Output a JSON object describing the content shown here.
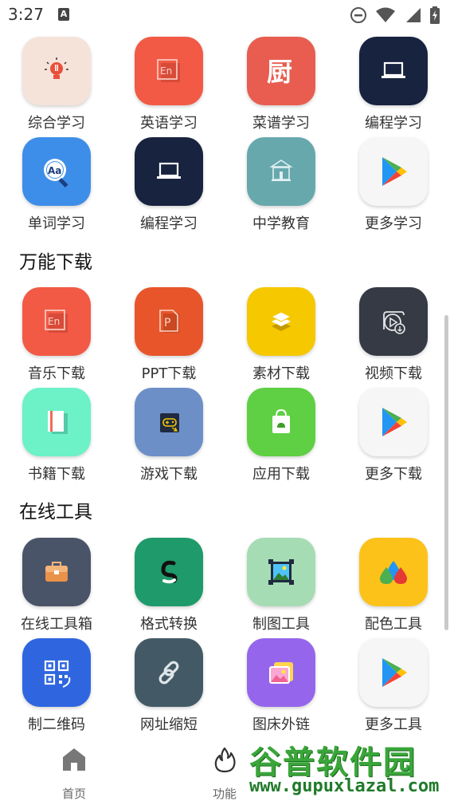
{
  "status_bar": {
    "time": "3:27",
    "notification_icon": "A"
  },
  "sections": [
    {
      "title": "",
      "items": [
        {
          "label": "综合学习",
          "icon": "lightbulb-icon",
          "color": "#f5e3da"
        },
        {
          "label": "英语学习",
          "icon": "en-doc-icon",
          "color": "#f25a45"
        },
        {
          "label": "菜谱学习",
          "icon": "chu-character-icon",
          "color": "#e85d50"
        },
        {
          "label": "编程学习",
          "icon": "laptop-icon",
          "color": "#17233f"
        },
        {
          "label": "单词学习",
          "icon": "magnifier-aa-icon",
          "color": "#3d8ee8"
        },
        {
          "label": "编程学习",
          "icon": "laptop-icon",
          "color": "#17233f"
        },
        {
          "label": "中学教育",
          "icon": "school-icon",
          "color": "#67a8ad"
        },
        {
          "label": "更多学习",
          "icon": "play-store-icon",
          "color": "#f6f6f6"
        }
      ]
    },
    {
      "title": "万能下载",
      "items": [
        {
          "label": "音乐下载",
          "icon": "en-doc-icon",
          "color": "#f25a45"
        },
        {
          "label": "PPT下载",
          "icon": "ppt-icon",
          "color": "#e8552a"
        },
        {
          "label": "素材下载",
          "icon": "layers-icon",
          "color": "#f5c800"
        },
        {
          "label": "视频下载",
          "icon": "video-download-icon",
          "color": "#353a44"
        },
        {
          "label": "书籍下载",
          "icon": "book-icon",
          "color": "#6df1c6"
        },
        {
          "label": "游戏下载",
          "icon": "gamepad-icon",
          "color": "#6d8fc8"
        },
        {
          "label": "应用下载",
          "icon": "shopping-bag-icon",
          "color": "#5fcf43"
        },
        {
          "label": "更多下载",
          "icon": "play-store-icon",
          "color": "#f6f6f6"
        }
      ]
    },
    {
      "title": "在线工具",
      "items": [
        {
          "label": "在线工具箱",
          "icon": "toolbox-icon",
          "color": "#4a5468"
        },
        {
          "label": "格式转换",
          "icon": "convert-icon",
          "color": "#1f9a6b"
        },
        {
          "label": "制图工具",
          "icon": "picture-frame-icon",
          "color": "#a6dcb4"
        },
        {
          "label": "配色工具",
          "icon": "color-drops-icon",
          "color": "#fcc21a"
        },
        {
          "label": "制二维码",
          "icon": "qr-code-icon",
          "color": "#2f66e0"
        },
        {
          "label": "网址缩短",
          "icon": "link-icon",
          "color": "#435a66"
        },
        {
          "label": "图床外链",
          "icon": "gallery-icon",
          "color": "#9566ec"
        },
        {
          "label": "更多工具",
          "icon": "play-store-icon",
          "color": "#f6f6f6"
        }
      ]
    }
  ],
  "bottom_nav": {
    "items": [
      {
        "label": "首页",
        "icon": "home-icon"
      },
      {
        "label": "功能",
        "icon": "flame-icon"
      }
    ]
  },
  "watermark": {
    "title": "谷普软件园",
    "url": "www.gupuxlazal.com"
  }
}
